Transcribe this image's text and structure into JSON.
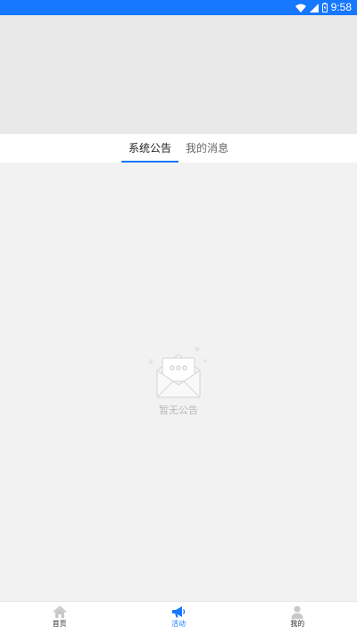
{
  "status_bar": {
    "time": "9:58",
    "icons": [
      "wifi-icon",
      "signal-icon",
      "battery-icon"
    ]
  },
  "tabs": [
    {
      "label": "系统公告",
      "active": true
    },
    {
      "label": "我的消息",
      "active": false
    }
  ],
  "empty_state": {
    "icon": "envelope-icon",
    "text": "暂无公告"
  },
  "tabbar": {
    "items": [
      {
        "label": "首页",
        "icon": "home-icon",
        "active": false
      },
      {
        "label": "活动",
        "icon": "megaphone-icon",
        "active": true
      },
      {
        "label": "我的",
        "icon": "user-icon",
        "active": false
      }
    ]
  },
  "colors": {
    "accent": "#1677ff",
    "background": "#f2f2f2",
    "banner": "#e9e9e9"
  }
}
